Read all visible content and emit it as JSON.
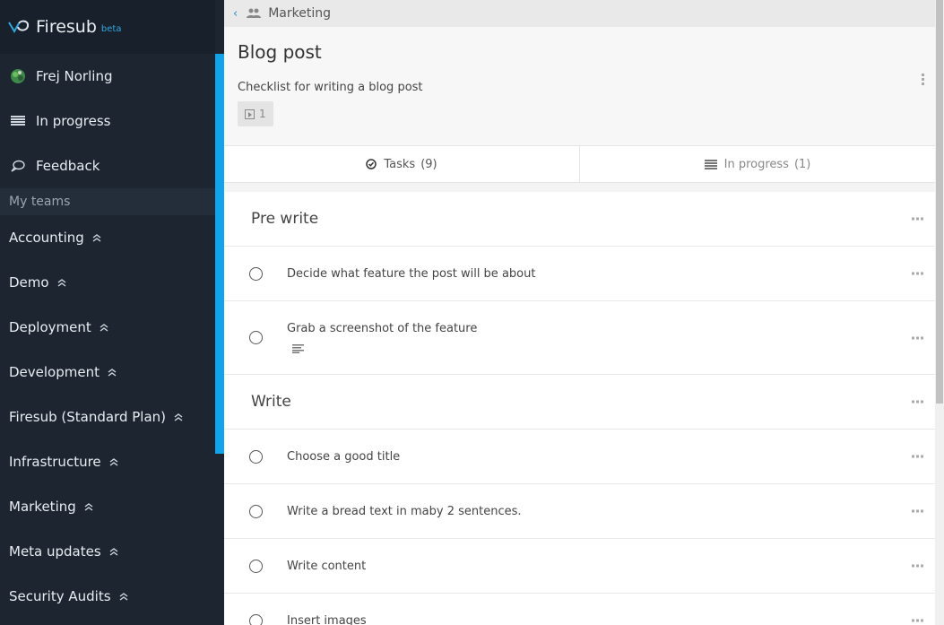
{
  "brand": {
    "name": "Firesub",
    "tag": "beta"
  },
  "sidebar": {
    "user": {
      "name": "Frej Norling"
    },
    "items": [
      {
        "label": "In progress",
        "icon": "list-icon"
      },
      {
        "label": "Feedback",
        "icon": "speech-bubble-icon"
      }
    ],
    "teams_header": "My teams",
    "teams": [
      {
        "label": "Accounting"
      },
      {
        "label": "Demo"
      },
      {
        "label": "Deployment"
      },
      {
        "label": "Development"
      },
      {
        "label": "Firesub (Standard Plan)"
      },
      {
        "label": "Infrastructure"
      },
      {
        "label": "Marketing"
      },
      {
        "label": "Meta updates"
      },
      {
        "label": "Security Audits"
      }
    ]
  },
  "breadcrumb": {
    "back": "‹",
    "team": "Marketing"
  },
  "checklist": {
    "title": "Blog post",
    "description": "Checklist for writing a blog post",
    "run_count": "1"
  },
  "tabs": [
    {
      "label": "Tasks",
      "count": "(9)",
      "icon": "check-circle-icon"
    },
    {
      "label": "In progress",
      "count": "(1)",
      "icon": "list-icon"
    }
  ],
  "sections": [
    {
      "title": "Pre write",
      "tasks": [
        {
          "text": "Decide what feature the post will be about"
        },
        {
          "text": "Grab a screenshot of the feature",
          "has_notes": true
        }
      ]
    },
    {
      "title": "Write",
      "tasks": [
        {
          "text": "Choose a good title"
        },
        {
          "text": "Write a bread text in maby 2 sentences."
        },
        {
          "text": "Write content"
        },
        {
          "text": "Insert images"
        }
      ]
    }
  ],
  "colors": {
    "sidebar_bg": "#1c2530",
    "accent": "#12a4ea",
    "brand_beta": "#2fa8e0"
  }
}
